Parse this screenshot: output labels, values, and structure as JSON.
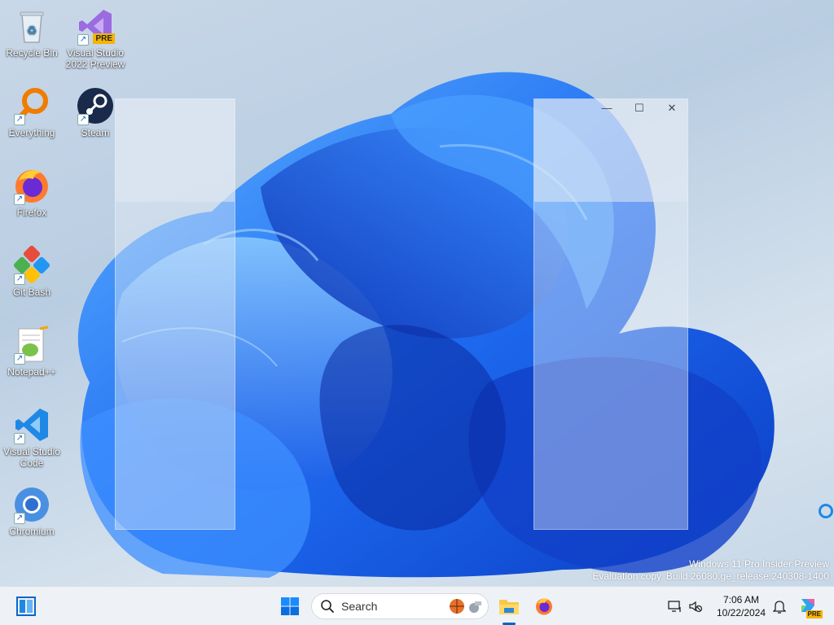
{
  "desktop": {
    "icons": [
      {
        "label": "Recycle Bin",
        "icon": "recycle-bin-icon",
        "shortcut": false
      },
      {
        "label": "Visual Studio 2022 Preview",
        "icon": "visual-studio-preview-icon",
        "badge": "PRE",
        "shortcut": true
      },
      {
        "label": "Everything",
        "icon": "everything-search-icon",
        "shortcut": true
      },
      {
        "label": "Steam",
        "icon": "steam-icon",
        "shortcut": true
      },
      {
        "label": "Firefox",
        "icon": "firefox-icon",
        "shortcut": true
      },
      {
        "label": "Git Bash",
        "icon": "git-bash-icon",
        "shortcut": true
      },
      {
        "label": "Notepad++",
        "icon": "notepad-plus-plus-icon",
        "shortcut": true
      },
      {
        "label": "Visual Studio Code",
        "icon": "vscode-icon",
        "shortcut": true
      },
      {
        "label": "Chromium",
        "icon": "chromium-icon",
        "shortcut": true
      }
    ],
    "window_controls": {
      "minimize": "—",
      "maximize": "☐",
      "close": "✕"
    },
    "watermark": {
      "line1": "Windows 11 Pro Insider Preview",
      "line2": "Evaluation copy. Build 26080.ge_release.240308-1400"
    }
  },
  "taskbar": {
    "widgets_icon": "widgets-icon",
    "start_icon": "windows-start-icon",
    "search_placeholder": "Search",
    "pinned": [
      {
        "name": "file-explorer-icon",
        "active": true
      },
      {
        "name": "firefox-icon",
        "active": false
      }
    ],
    "tray": {
      "time": "7:06 AM",
      "date": "10/22/2024",
      "copilot_badge": "PRE"
    }
  },
  "colors": {
    "accent": "#0067c0",
    "taskbar_bg": "#eef1f5",
    "bloom_blue": "#1a5ff0"
  }
}
